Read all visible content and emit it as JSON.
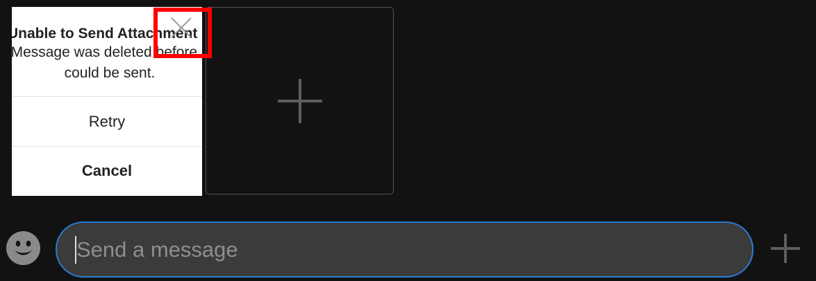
{
  "attachment": {
    "alert_title": "Unable to Send Attachment",
    "alert_message": "Message was deleted before it could be sent.",
    "retry_label": "Retry",
    "cancel_label": "Cancel",
    "close_icon": "close-icon",
    "highlight_color": "#ff0000"
  },
  "add_tile": {
    "icon": "plus-icon"
  },
  "composer": {
    "emoji_icon": "smiley-icon",
    "placeholder": "Send a message",
    "value": "",
    "accent_color": "#2b7bd4",
    "send_plus_icon": "plus-icon"
  }
}
